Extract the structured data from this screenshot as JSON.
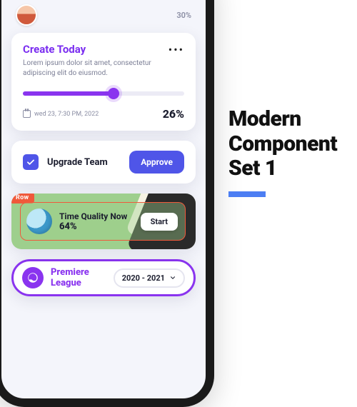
{
  "topbar": {
    "progress_pct": "30%"
  },
  "create": {
    "title": "Create Today",
    "menu_dots": "•••",
    "desc": "Lorem ipsum dolor sit amet, consectetur adipiscing elit do eiusmod.",
    "date": "wed 23, 7:30 PM, 2022",
    "slider_pct": "26%"
  },
  "upgrade": {
    "label": "Upgrade Team",
    "button": "Approve",
    "checked": true
  },
  "time": {
    "tag": "Row",
    "title": "Time Quality Now",
    "pct": "64%",
    "button": "Start"
  },
  "league": {
    "title": "Premiere League",
    "season": "2020 - 2021"
  },
  "heading": {
    "line1": "Modern",
    "line2": "Component",
    "line3": "Set 1"
  },
  "colors": {
    "purple": "#8a34ef",
    "indigo": "#4f55e8",
    "blue_accent": "#4c7ef3",
    "orange": "#f0593b",
    "green": "#9ecf8d"
  }
}
